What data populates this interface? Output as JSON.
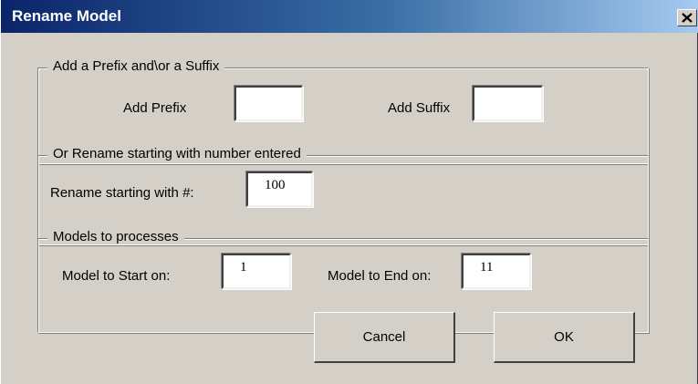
{
  "window": {
    "title": "Rename Model",
    "close_icon": "close-icon"
  },
  "prefix_suffix_group": {
    "legend": "Add a Prefix and\\or a Suffix",
    "prefix_label": "Add Prefix",
    "prefix_value": "",
    "suffix_label": "Add Suffix",
    "suffix_value": ""
  },
  "rename_group": {
    "legend": "Or Rename starting with number entered",
    "start_label": "Rename starting with #:",
    "start_value": "100"
  },
  "models_group": {
    "legend": "Models to processes",
    "start_label": "Model to Start on:",
    "start_value": "1",
    "end_label": "Model to End on:",
    "end_value": "11"
  },
  "buttons": {
    "cancel_label": "Cancel",
    "ok_label": "OK"
  },
  "colors": {
    "face": "#d4d0c8",
    "titlebar_start": "#0a246a",
    "titlebar_end": "#a6caf0"
  }
}
